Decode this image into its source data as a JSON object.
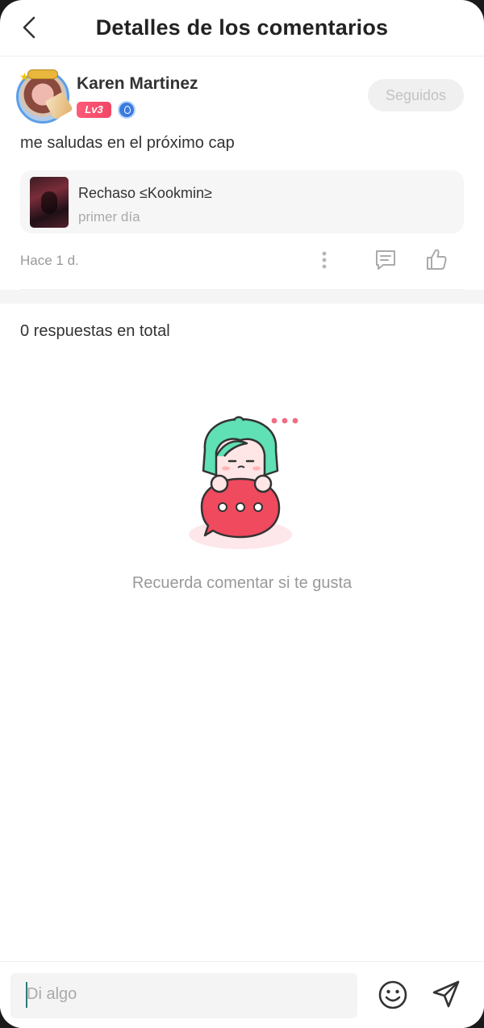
{
  "header": {
    "title": "Detalles de los comentarios",
    "back_icon": "chevron-left-icon"
  },
  "comment": {
    "username": "Karen Martinez",
    "level": "Lv3",
    "follow_label": "Seguidos",
    "text": "me saludas en el próximo cap",
    "book": {
      "title": "Rechaso ≤Kookmin≥",
      "chapter": "primer día"
    },
    "time": "Hace 1 d.",
    "icons": [
      "more-vertical-icon",
      "comment-icon",
      "thumbs-up-icon"
    ]
  },
  "replies": {
    "total_label": "0 respuestas en total",
    "empty_text": "Recuerda comentar si te gusta"
  },
  "composer": {
    "placeholder": "Di algo",
    "icons": [
      "emoji-icon",
      "send-icon"
    ]
  },
  "colors": {
    "accent_pink": "#f04766",
    "mascot_green": "#5fe0b5",
    "mascot_red": "#f04a5e",
    "caret": "#2a7c78"
  }
}
